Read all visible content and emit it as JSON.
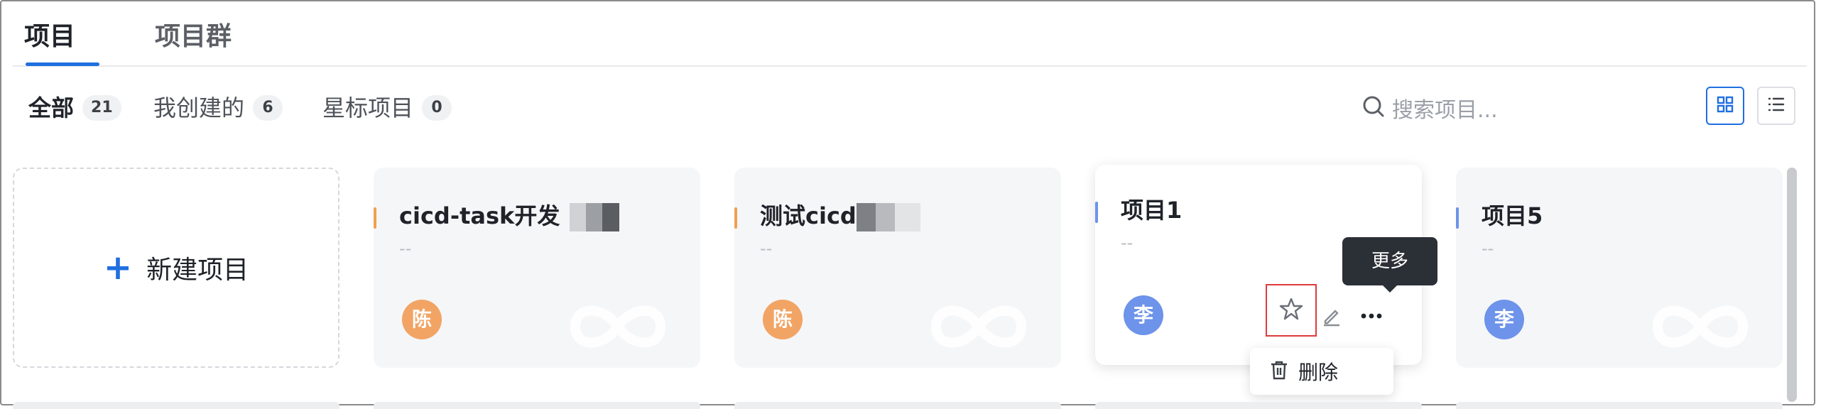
{
  "tabs": [
    {
      "label": "项目",
      "active": true
    },
    {
      "label": "项目群",
      "active": false
    }
  ],
  "filters": [
    {
      "label": "全部",
      "count": "21"
    },
    {
      "label": "我创建的",
      "count": "6"
    },
    {
      "label": "星标项目",
      "count": "0"
    }
  ],
  "search": {
    "placeholder": "搜索项目..."
  },
  "new_project": {
    "label": "新建项目"
  },
  "projects": [
    {
      "name": "cicd-task开发",
      "desc": "--",
      "avatar": "陈",
      "accent": "#f0a050",
      "avatar_color": "#f2a464"
    },
    {
      "name": "测试cicd",
      "desc": "--",
      "avatar": "陈",
      "accent": "#f0a050",
      "avatar_color": "#f2a464"
    },
    {
      "name": "项目1",
      "desc": "--",
      "avatar": "李",
      "accent": "#6d93ea",
      "avatar_color": "#6d93ea"
    },
    {
      "name": "项目5",
      "desc": "--",
      "avatar": "李",
      "accent": "#6d93ea",
      "avatar_color": "#6d93ea"
    }
  ],
  "tooltip": {
    "text": "更多"
  },
  "menu": {
    "delete_label": "删除"
  },
  "colors": {
    "primary": "#1f6fe0",
    "highlight": "#e03a3a"
  }
}
